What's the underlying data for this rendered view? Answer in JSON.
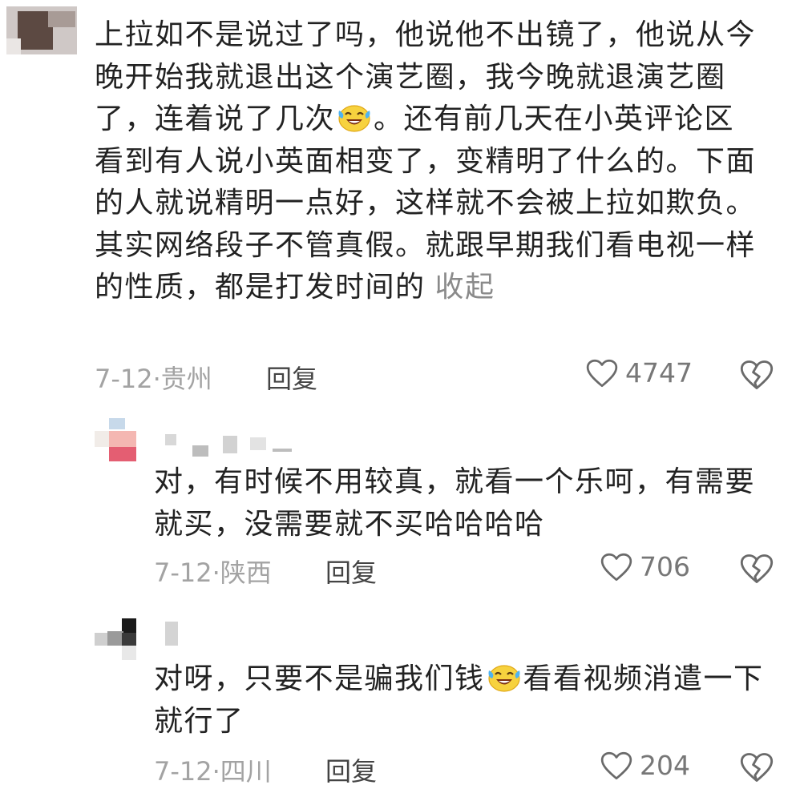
{
  "comments": [
    {
      "segments": [
        "上拉如不是说过了吗，他说他不出镜了，他说从今晚开始我就退出这个演艺圈，我今晚就退演艺圈了，连着说了几次",
        "。还有前几天在小英评论区看到有人说小英面相变了，变精明了什么的。下面的人就说精明一点好，这样就不会被上拉如欺负。其实网络段子不管真假。就跟早期我们看电视一样的性质，都是打发时间的"
      ],
      "emoji_icon": "crying-laughing-emoji",
      "collapse_label": "收起",
      "date": "7-12",
      "location": "贵州",
      "reply_label": "回复",
      "likes": "4747"
    },
    {
      "segments": [
        "对，有时候不用较真，就看一个乐呵，有需要就买，没需要就不买哈哈哈哈"
      ],
      "date": "7-12",
      "location": "陕西",
      "reply_label": "回复",
      "likes": "706"
    },
    {
      "segments": [
        "对呀，只要不是骗我们钱",
        "看看视频消遣一下就行了"
      ],
      "emoji_icon": "crying-laughing-emoji",
      "date": "7-12",
      "location": "四川",
      "reply_label": "回复",
      "likes": "204"
    }
  ],
  "colors": {
    "text": "#222222",
    "meta": "#a3a3a3",
    "reply": "#444444",
    "likes": "#777777"
  },
  "icons": [
    "heart-outline-icon",
    "broken-heart-icon",
    "crying-laughing-emoji"
  ]
}
